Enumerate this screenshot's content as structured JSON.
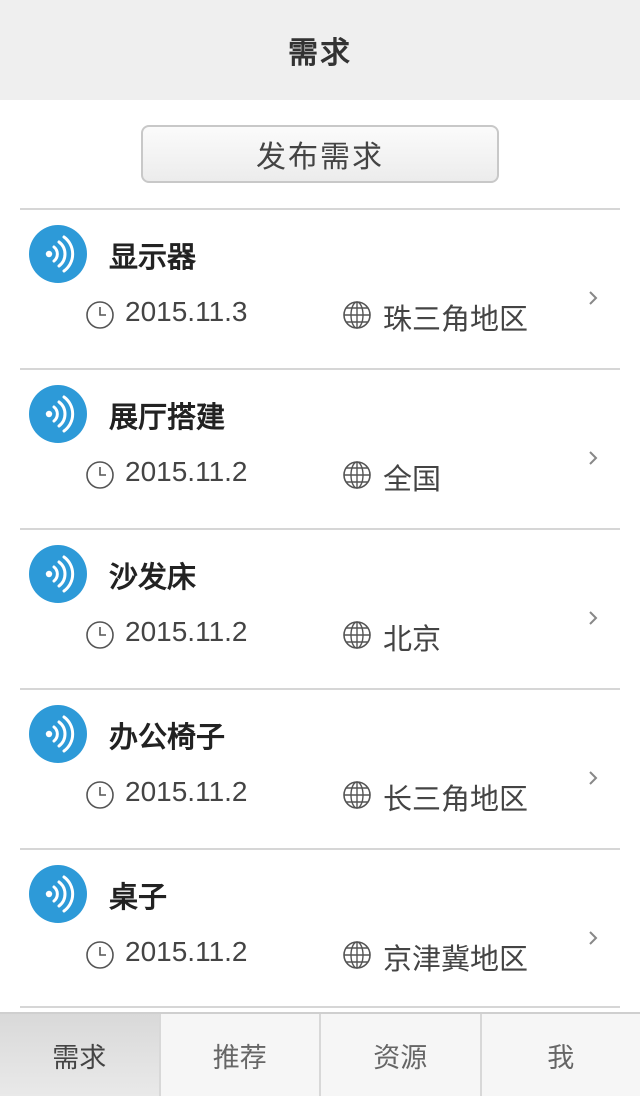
{
  "header": {
    "title": "需求"
  },
  "publish_button": {
    "label": "发布需求"
  },
  "items": [
    {
      "title": "显示器",
      "date": "2015.11.3",
      "region": "珠三角地区"
    },
    {
      "title": "展厅搭建",
      "date": "2015.11.2",
      "region": "全国"
    },
    {
      "title": "沙发床",
      "date": "2015.11.2",
      "region": "北京"
    },
    {
      "title": "办公椅子",
      "date": "2015.11.2",
      "region": "长三角地区"
    },
    {
      "title": "桌子",
      "date": "2015.11.2",
      "region": "京津冀地区"
    }
  ],
  "icons": {
    "item": "broadcast-icon",
    "date": "clock-icon",
    "region": "globe-icon",
    "open": "chevron-right-icon"
  },
  "colors": {
    "accent": "#2d9ad8",
    "header_bg": "#efefef"
  },
  "tabs": [
    {
      "label": "需求",
      "active": true
    },
    {
      "label": "推荐",
      "active": false
    },
    {
      "label": "资源",
      "active": false
    },
    {
      "label": "我",
      "active": false
    }
  ]
}
